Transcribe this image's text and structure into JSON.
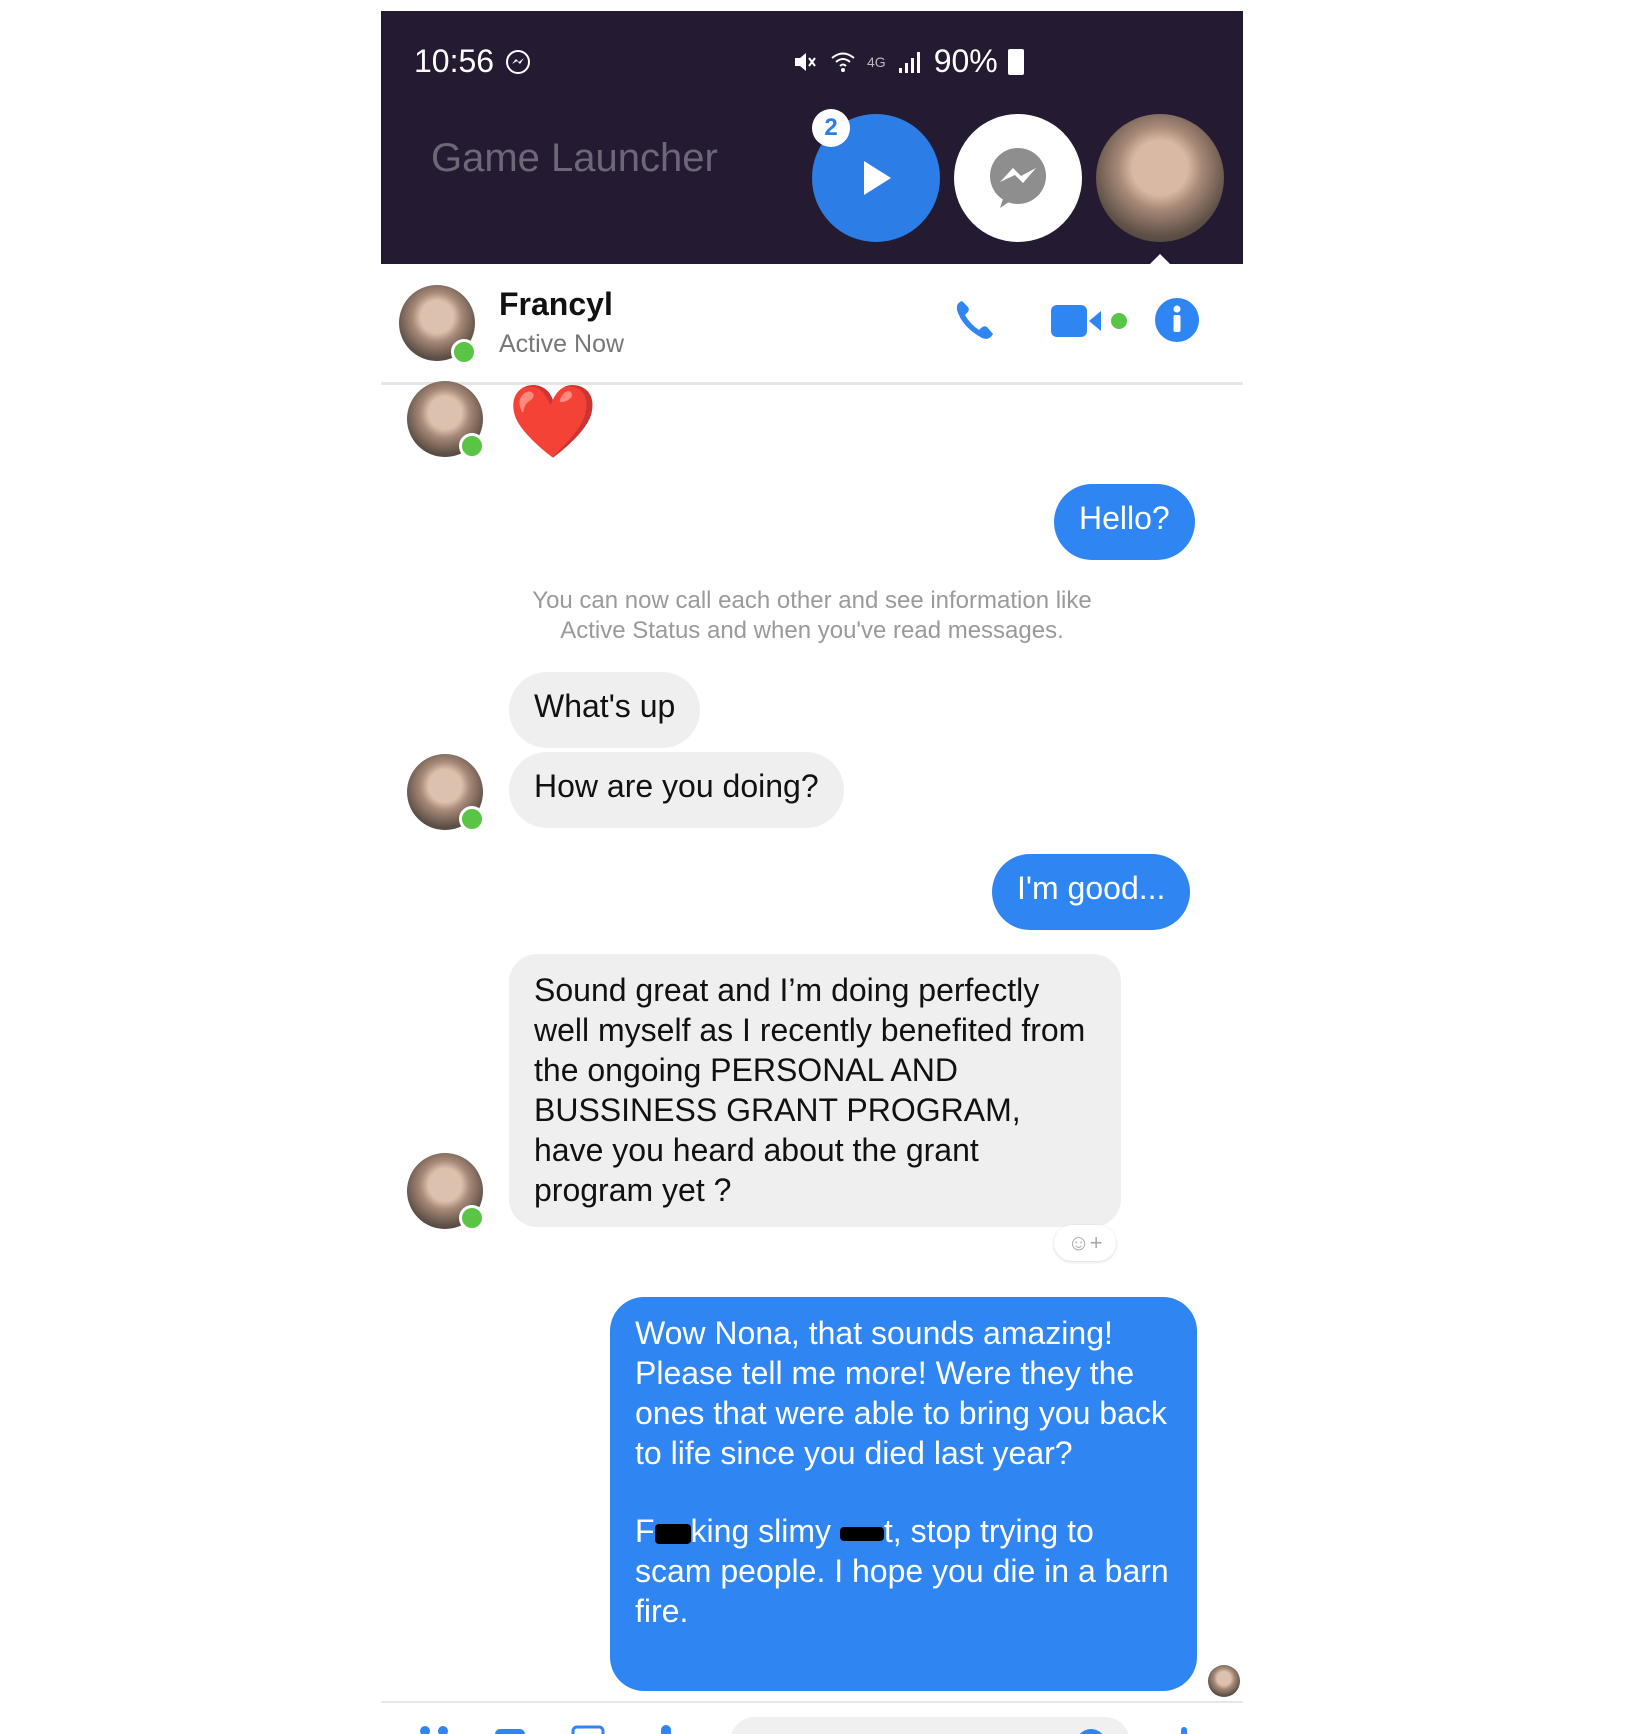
{
  "status_bar": {
    "time": "10:56",
    "battery": "90%",
    "network": "4G"
  },
  "launcher": {
    "title": "Game Launcher",
    "badge_count": "2"
  },
  "header": {
    "contact_name": "Francyl",
    "status": "Active Now"
  },
  "messages": [
    {
      "from": "them",
      "text": "❤️"
    },
    {
      "from": "me",
      "text": "Hello?"
    },
    {
      "from": "system",
      "text": "You can now call each other and see information like Active Status and when you've read messages."
    },
    {
      "from": "them",
      "text": "What's up"
    },
    {
      "from": "them",
      "text": "How are you doing?"
    },
    {
      "from": "me",
      "text": "I'm good..."
    },
    {
      "from": "them",
      "text": "Sound great and I’m doing perfectly well myself as I recently benefited from the ongoing PERSONAL AND BUSSINESS GRANT PROGRAM, have you heard about the grant program yet ?"
    },
    {
      "from": "me",
      "text": "Wow Nona, that sounds amazing! Please tell me more! Were they the ones that were able to bring you back to life since you died last year?"
    },
    {
      "from": "me",
      "text_parts": [
        "F",
        "king slimy ",
        "t, stop trying to scam people. I hope you die in a barn fire."
      ]
    }
  ],
  "colors": {
    "accent": "#2f86f2",
    "online": "#5ac447",
    "topbar": "#241b33",
    "incoming_bubble": "#efefef"
  },
  "icons": [
    "messenger-icon",
    "mute-icon",
    "wifi-icon",
    "signal-icon",
    "battery-icon",
    "play-icon",
    "phone-icon",
    "video-icon",
    "info-icon",
    "reaction-icon",
    "apps-icon",
    "camera-icon",
    "gallery-icon",
    "mic-icon",
    "emoji-icon",
    "like-icon"
  ]
}
